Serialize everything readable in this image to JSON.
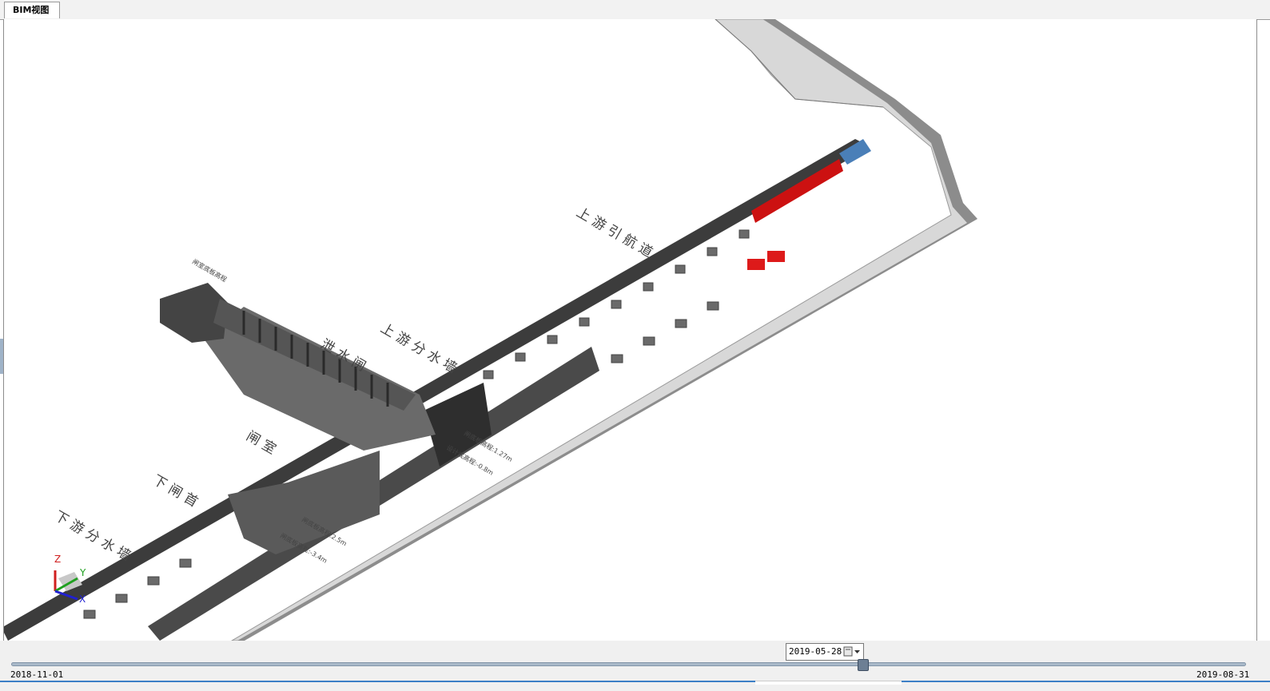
{
  "tab": {
    "title": "BIM视图"
  },
  "labels": {
    "upstream_channel": "上 游 引 航 道",
    "upstream_wall": "上 游 分 水 墙",
    "sluice": "泄 水 闸",
    "lock_chamber": "闸 室",
    "lower_head": "下 闸 首",
    "downstream_wall": "下 游 分 水 墙",
    "anno_top": "闸室底板高程",
    "anno_c1": "闸底板高程:1.27m",
    "anno_c2": "设计底高程:-0.8m",
    "anno_c3": "闸底板高程:2.5m",
    "anno_c4": "闸底板高程:-3.4m"
  },
  "axes": {
    "z": "Z",
    "y": "Y",
    "x": "X"
  },
  "timeline": {
    "current_date": "2019-05-28",
    "start_date": "2018-11-01",
    "end_date": "2019-08-31",
    "position": 0.69
  },
  "colors": {
    "structure": "#3a3a3a",
    "highlight": "#cc1111",
    "selected": "#4a7fb8",
    "bank": "#9a9a9a"
  },
  "icons": {
    "calendar": "calendar-icon",
    "dropdown": "chevron-down-icon"
  }
}
